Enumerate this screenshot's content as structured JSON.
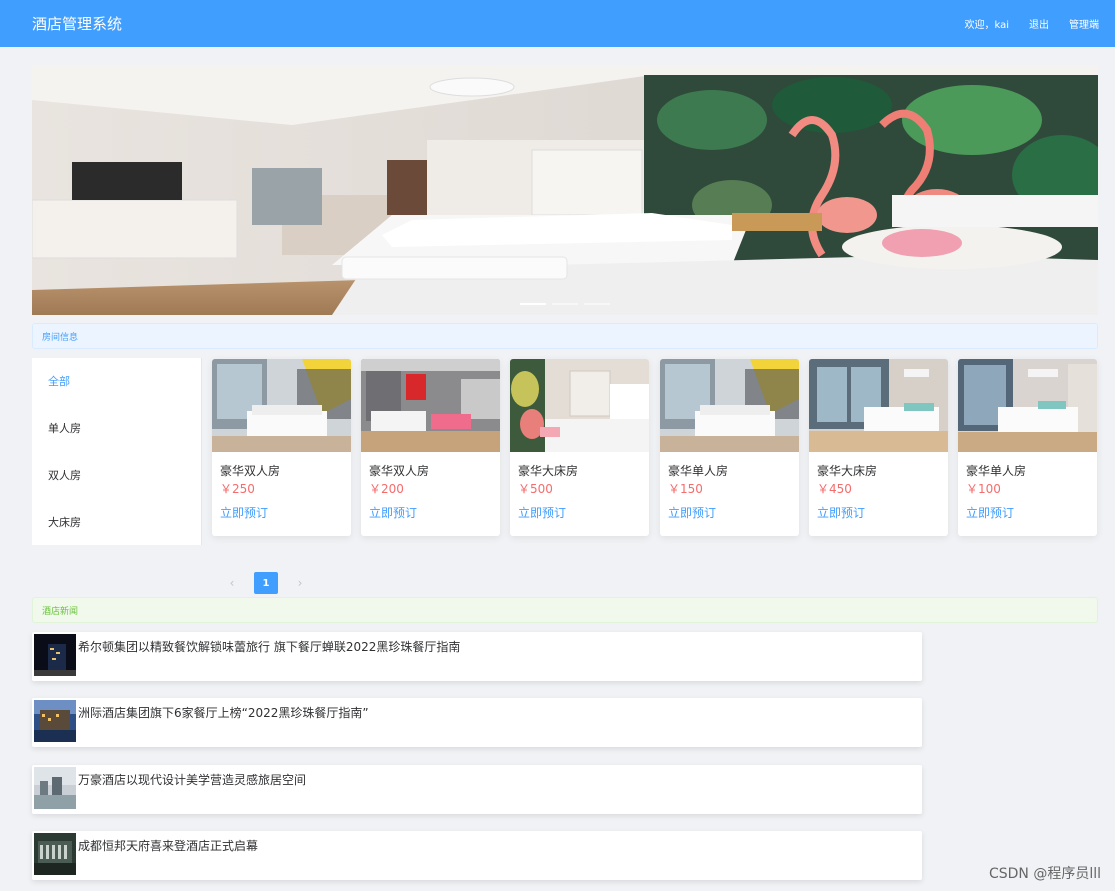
{
  "header": {
    "title": "酒店管理系统",
    "welcome": "欢迎，kai",
    "logout": "退出",
    "admin": "管理端"
  },
  "rooms_section": {
    "heading": "房间信息",
    "categories": [
      "全部",
      "单人房",
      "双人房",
      "大床房"
    ],
    "active_category": "全部",
    "rooms": [
      {
        "name": "豪华双人房",
        "price": "￥250",
        "book": "立即预订"
      },
      {
        "name": "豪华双人房",
        "price": "￥200",
        "book": "立即预订"
      },
      {
        "name": "豪华大床房",
        "price": "￥500",
        "book": "立即预订"
      },
      {
        "name": "豪华单人房",
        "price": "￥150",
        "book": "立即预订"
      },
      {
        "name": "豪华大床房",
        "price": "￥450",
        "book": "立即预订"
      },
      {
        "name": "豪华单人房",
        "price": "￥100",
        "book": "立即预订"
      }
    ]
  },
  "pagination": {
    "prev": "‹",
    "current": "1",
    "next": "›"
  },
  "news_section": {
    "heading": "酒店新闻",
    "items": [
      "希尔顿集团以精致餐饮解锁味蕾旅行 旗下餐厅蝉联2022黑珍珠餐厅指南",
      "洲际酒店集团旗下6家餐厅上榜“2022黑珍珠餐厅指南”",
      "万豪酒店以现代设计美学营造灵感旅居空间",
      "成都恒邦天府喜来登酒店正式启幕"
    ]
  },
  "carousel": {
    "slide_count": 3,
    "active_slide": 1
  },
  "watermark": "CSDN @程序员lll",
  "colors": {
    "primary": "#409eff",
    "price": "#f56c6c",
    "success": "#67c23a",
    "page_bg": "#f0f2f5"
  }
}
